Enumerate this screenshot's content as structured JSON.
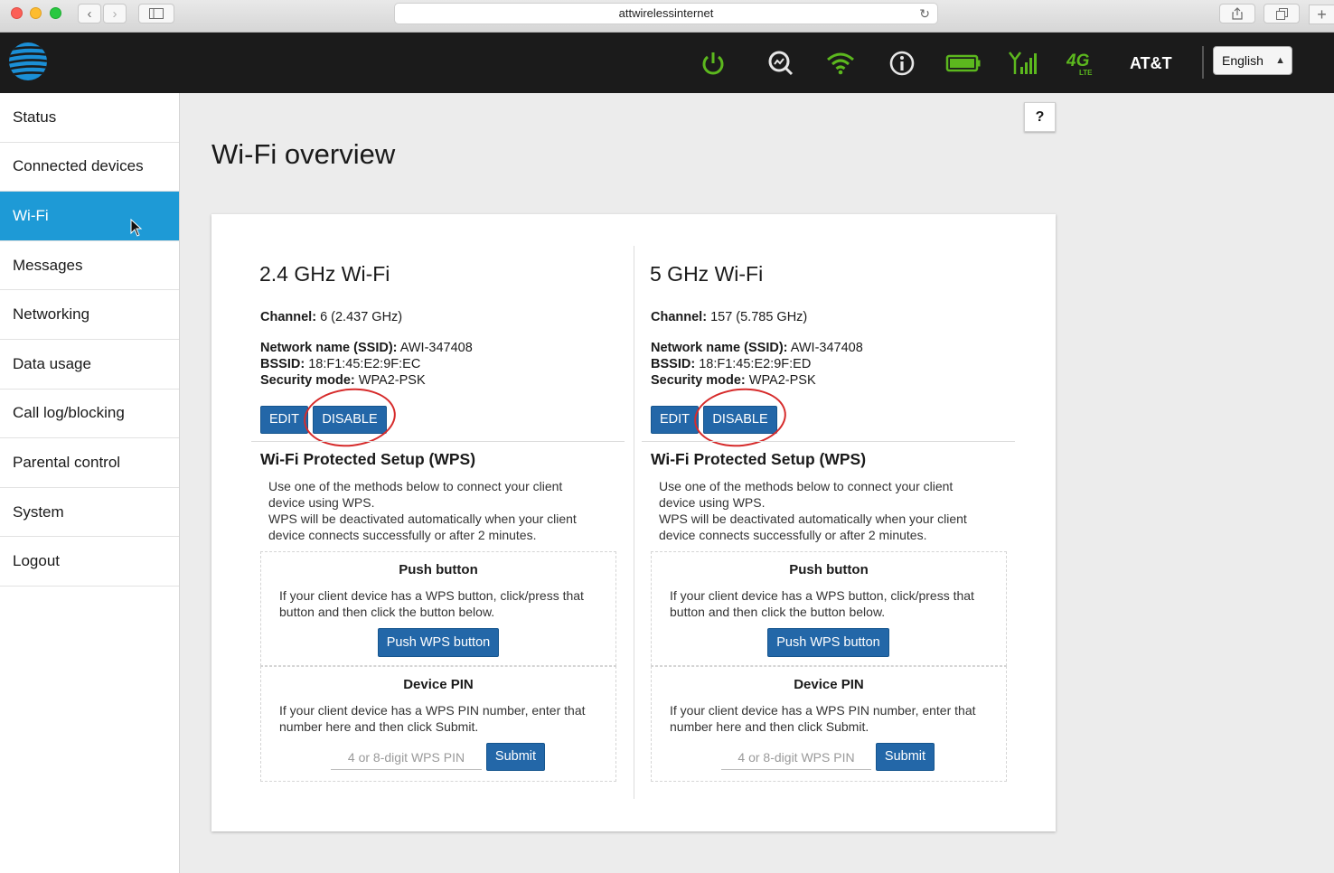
{
  "browser": {
    "url": "attwirelessinternet"
  },
  "header": {
    "brand": "AT&T",
    "language": "English"
  },
  "sidebar": {
    "items": [
      {
        "label": "Status"
      },
      {
        "label": "Connected devices"
      },
      {
        "label": "Wi-Fi"
      },
      {
        "label": "Messages"
      },
      {
        "label": "Networking"
      },
      {
        "label": "Data usage"
      },
      {
        "label": "Call log/blocking"
      },
      {
        "label": "Parental control"
      },
      {
        "label": "System"
      },
      {
        "label": "Logout"
      }
    ],
    "active": "Wi-Fi"
  },
  "main": {
    "help": "?",
    "title": "Wi-Fi overview",
    "bands": [
      {
        "title": "2.4 GHz Wi-Fi",
        "channel_label": "Channel:",
        "channel_value": "6 (2.437 GHz)",
        "ssid_label": "Network name (SSID):",
        "ssid_value": "AWI-347408",
        "bssid_label": "BSSID:",
        "bssid_value": "18:F1:45:E2:9F:EC",
        "security_label": "Security mode:",
        "security_value": "WPA2-PSK",
        "edit": "EDIT",
        "disable": "DISABLE",
        "wps_title": "Wi-Fi Protected Setup (WPS)",
        "wps_desc_1": "Use one of the methods below to connect your client device using WPS.",
        "wps_desc_2": "WPS will be deactivated automatically when your client device connects successfully or after 2 minutes.",
        "push_title": "Push button",
        "push_desc": "If your client device has a WPS button, click/press that button and then click the button below.",
        "push_button": "Push WPS button",
        "pin_title": "Device PIN",
        "pin_desc": "If your client device has a WPS PIN number, enter that number here and then click Submit.",
        "pin_placeholder": "4 or 8-digit WPS PIN",
        "submit": "Submit"
      },
      {
        "title": "5 GHz Wi-Fi",
        "channel_label": "Channel:",
        "channel_value": "157 (5.785 GHz)",
        "ssid_label": "Network name (SSID):",
        "ssid_value": "AWI-347408",
        "bssid_label": "BSSID:",
        "bssid_value": "18:F1:45:E2:9F:ED",
        "security_label": "Security mode:",
        "security_value": "WPA2-PSK",
        "edit": "EDIT",
        "disable": "DISABLE",
        "wps_title": "Wi-Fi Protected Setup (WPS)",
        "wps_desc_1": "Use one of the methods below to connect your client device using WPS.",
        "wps_desc_2": "WPS will be deactivated automatically when your client device connects successfully or after 2 minutes.",
        "push_title": "Push button",
        "push_desc": "If your client device has a WPS button, click/press that button and then click the button below.",
        "push_button": "Push WPS button",
        "pin_title": "Device PIN",
        "pin_desc": "If your client device has a WPS PIN number, enter that number here and then click Submit.",
        "pin_placeholder": "4 or 8-digit WPS PIN",
        "submit": "Submit"
      }
    ]
  },
  "colors": {
    "accent": "#1e9ad6",
    "button": "#2367a8",
    "status_green": "#5cb81e",
    "highlight_circle": "#d62b2b"
  },
  "icons": [
    "power-icon",
    "search-icon",
    "wifi-icon",
    "info-icon",
    "battery-icon",
    "signal-icon",
    "4g-lte-icon"
  ]
}
